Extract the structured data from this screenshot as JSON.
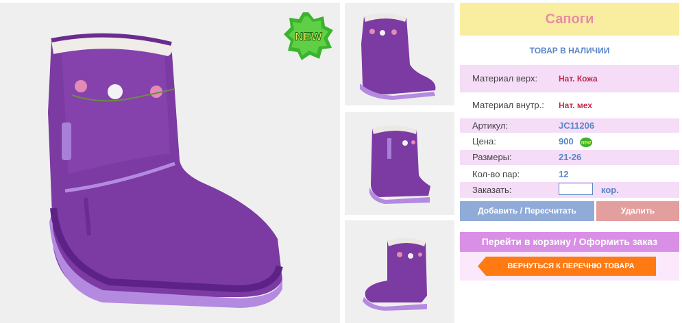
{
  "product": {
    "title": "Сапоги",
    "stock_status": "ТОВАР В НАЛИЧИИ",
    "new_badge": "NEW",
    "small_new_badge": "NEW"
  },
  "details": {
    "material_top_label": "Материал верх:",
    "material_top_value": "Нат. Кожа",
    "material_inner_label": "Материал внутр.:",
    "material_inner_value": "Нат. мех",
    "article_label": "Артикул:",
    "article_value": "JC11206",
    "price_label": "Цена:",
    "price_value": "900",
    "sizes_label": "Размеры:",
    "sizes_value": "21-26",
    "pairs_label": "Кол-во пар:",
    "pairs_value": "12",
    "order_label": "Заказать:",
    "order_value": "",
    "order_unit": "кор."
  },
  "buttons": {
    "add_recalc": "Добавить / Пересчитать",
    "delete": "Удалить",
    "checkout": "Перейти в корзину / Оформить заказ",
    "back": "ВЕРНУТЬСЯ К ПЕРЕЧНЮ ТОВАРА"
  },
  "colors": {
    "boot_purple": "#7c3aa3",
    "sole_lilac": "#b48ae0",
    "title_bg": "#f9eea0",
    "accent_blue": "#5a86c8",
    "back_orange": "#ff7a12"
  }
}
